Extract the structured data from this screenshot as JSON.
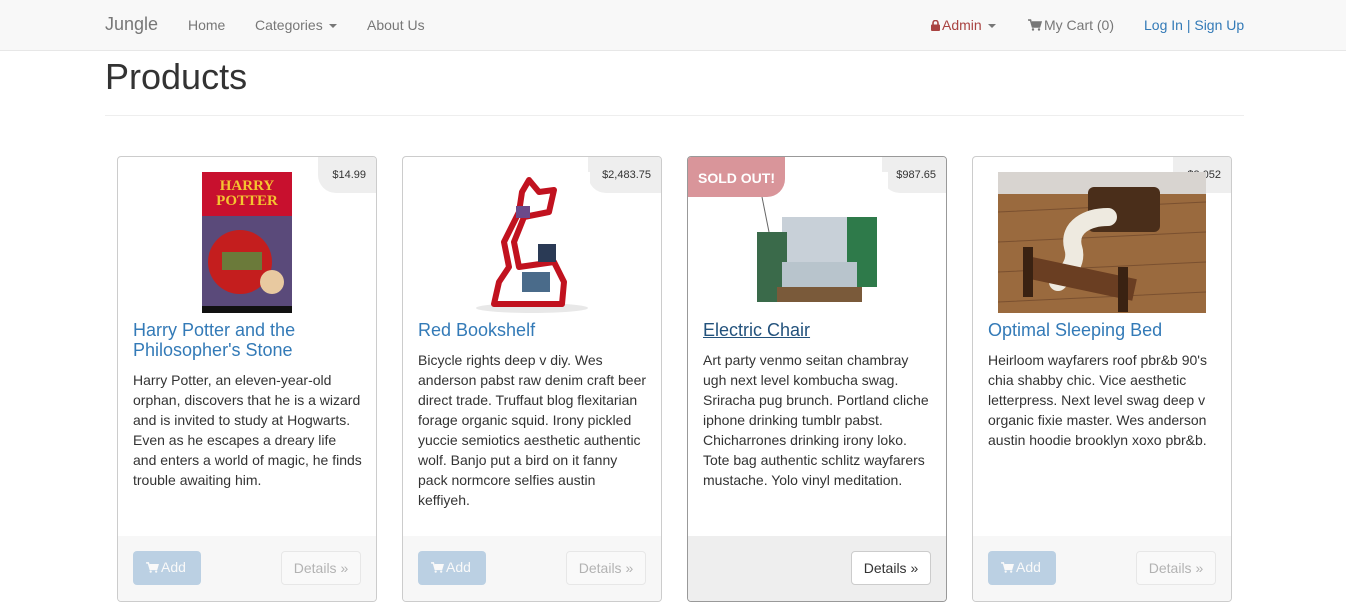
{
  "navbar": {
    "brand": "Jungle",
    "links": {
      "home": "Home",
      "categories": "Categories",
      "about": "About Us"
    },
    "admin": "Admin",
    "cart": "My Cart (0)",
    "login": "Log In",
    "separator": "|",
    "signup": "Sign Up"
  },
  "page": {
    "title": "Products"
  },
  "products": [
    {
      "name": "Harry Potter and the Philosopher's Stone",
      "price": "$14.99",
      "description": "Harry Potter, an eleven-year-old orphan, discovers that he is a wizard and is invited to study at Hogwarts. Even as he escapes a dreary life and enters a world of magic, he finds trouble awaiting him.",
      "sold_out": false,
      "add_label": "Add",
      "details_label": "Details »",
      "image": "harry-potter-book-cover"
    },
    {
      "name": "Red Bookshelf",
      "price": "$2,483.75",
      "description": "Bicycle rights deep v diy. Wes anderson pabst raw denim craft beer direct trade. Truffaut blog flexitarian forage organic squid. Irony pickled yuccie semiotics aesthetic authentic wolf. Banjo put a bird on it fanny pack normcore selfies austin keffiyeh.",
      "sold_out": false,
      "add_label": "Add",
      "details_label": "Details »",
      "image": "red-bookshelf"
    },
    {
      "name": "Electric Chair",
      "price": "$987.65",
      "description": "Art party venmo seitan chambray ugh next level kombucha swag. Sriracha pug brunch. Portland cliche iphone drinking tumblr pabst. Chicharrones drinking irony loko. Tote bag authentic schlitz wayfarers mustache. Yolo vinyl meditation.",
      "sold_out": true,
      "sold_out_label": "SOLD OUT!",
      "details_label": "Details »",
      "image": "circuit-board-chair"
    },
    {
      "name": "Optimal Sleeping Bed",
      "price": "$3,052",
      "description": "Heirloom wayfarers roof pbr&b 90's chia shabby chic. Vice aesthetic letterpress. Next level swag deep v organic fixie master. Wes anderson austin hoodie brooklyn xoxo pbr&b.",
      "sold_out": false,
      "add_label": "Add",
      "details_label": "Details »",
      "image": "s-shaped-bed"
    }
  ],
  "colors": {
    "link": "#337ab7",
    "admin": "#a94442",
    "sold_badge": "#d9959a",
    "navbar_bg": "#f8f8f8"
  }
}
